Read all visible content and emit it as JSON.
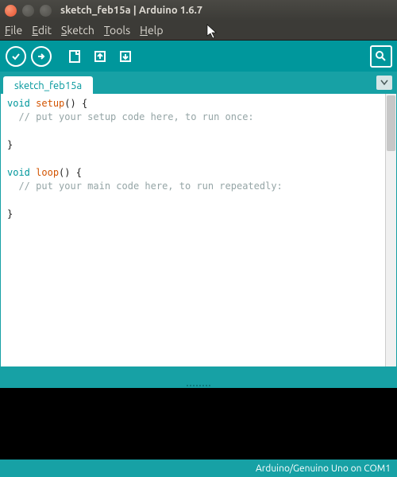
{
  "window": {
    "title": "sketch_feb15a | Arduino 1.6.7"
  },
  "menu": {
    "file": "File",
    "edit": "Edit",
    "sketch": "Sketch",
    "tools": "Tools",
    "help": "Help"
  },
  "tabs": {
    "active": "sketch_feb15a"
  },
  "code": {
    "l1_kw": "void",
    "l1_fn": "setup",
    "l1_rest": "() {",
    "l2": "  // put your setup code here, to run once:",
    "l3": "",
    "l4": "}",
    "l5": "",
    "l6_kw": "void",
    "l6_fn": "loop",
    "l6_rest": "() {",
    "l7": "  // put your main code here, to run repeatedly:",
    "l8": "",
    "l9": "}"
  },
  "status": {
    "board": "Arduino/Genuino Uno on COM1"
  },
  "colors": {
    "accent": "#00979c",
    "tabbar": "#17a1a5"
  }
}
